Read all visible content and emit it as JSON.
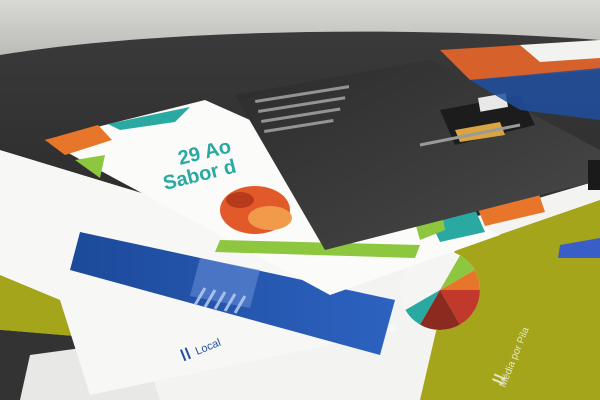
{
  "photo": {
    "colors": {
      "wall": "#c9c9c6",
      "table": "#2b2b2b",
      "lime": "#a4a51a",
      "blue": "#1f4fa0",
      "orange": "#e8762a",
      "green": "#8dc63f",
      "teal": "#2aa9a3",
      "red": "#c0392b",
      "paper": "#f1f1ef",
      "dark_cover": "#3a3a3a"
    },
    "brochure_text": {
      "headline_line1": "29 Ao",
      "headline_line2": "Sabor d",
      "lower_right_label": "Média por Pila",
      "lower_left_label": "Local"
    }
  }
}
